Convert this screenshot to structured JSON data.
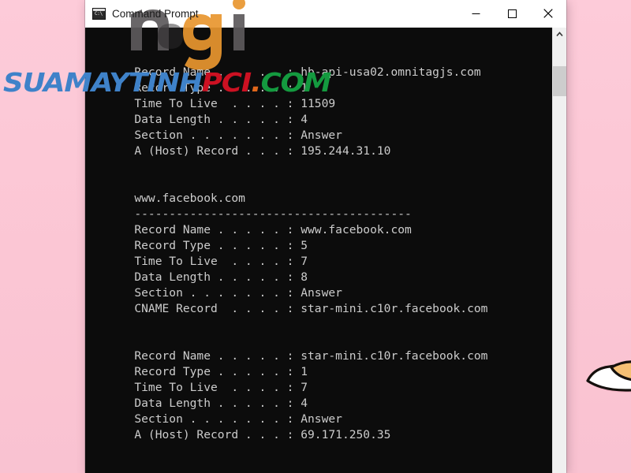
{
  "desktop": {
    "background_color": "#fbc8d6",
    "wallpaper_pet": "corgi-illustration"
  },
  "window": {
    "title": "Command Prompt",
    "icon": "cmd-icon",
    "icon_prompt_text": "C:\\",
    "controls": {
      "minimize": "Minimize",
      "maximize": "Maximize",
      "close": "Close"
    }
  },
  "console": {
    "background_color": "#0c0c0c",
    "foreground_color": "#cccccc",
    "lines": [
      "",
      "",
      "   Record Name . . . . . : hb-api-usa02.omnitagjs.com",
      "   Record Type . . . . . : 1",
      "   Time To Live  . . . . : 11509",
      "   Data Length . . . . . : 4",
      "   Section . . . . . . . : Answer",
      "   A (Host) Record . . . : 195.244.31.10",
      "",
      "",
      "   www.facebook.com",
      "   ----------------------------------------",
      "   Record Name . . . . . : www.facebook.com",
      "   Record Type . . . . . : 5",
      "   Time To Live  . . . . : 7",
      "   Data Length . . . . . : 8",
      "   Section . . . . . . . : Answer",
      "   CNAME Record  . . . . : star-mini.c10r.facebook.com",
      "",
      "",
      "   Record Name . . . . . : star-mini.c10r.facebook.com",
      "   Record Type . . . . . : 1",
      "   Time To Live  . . . . : 7",
      "   Data Length . . . . . : 4",
      "   Section . . . . . . . : Answer",
      "   A (Host) Record . . . : 69.171.250.35",
      "",
      ""
    ]
  },
  "scrollbar": {
    "up_arrow": "scroll-up",
    "down_arrow": "scroll-down",
    "thumb": "scroll-thumb"
  },
  "watermark": {
    "part1": "SUAMAYTINH",
    "part2": "PCI",
    "dot": ".",
    "part3": "COM",
    "color1": "#3f82c9",
    "color2": "#cc1122",
    "color_dot": "#e0671b",
    "color3": "#149a3f"
  },
  "ghost_logo": {
    "text": "ngi"
  }
}
